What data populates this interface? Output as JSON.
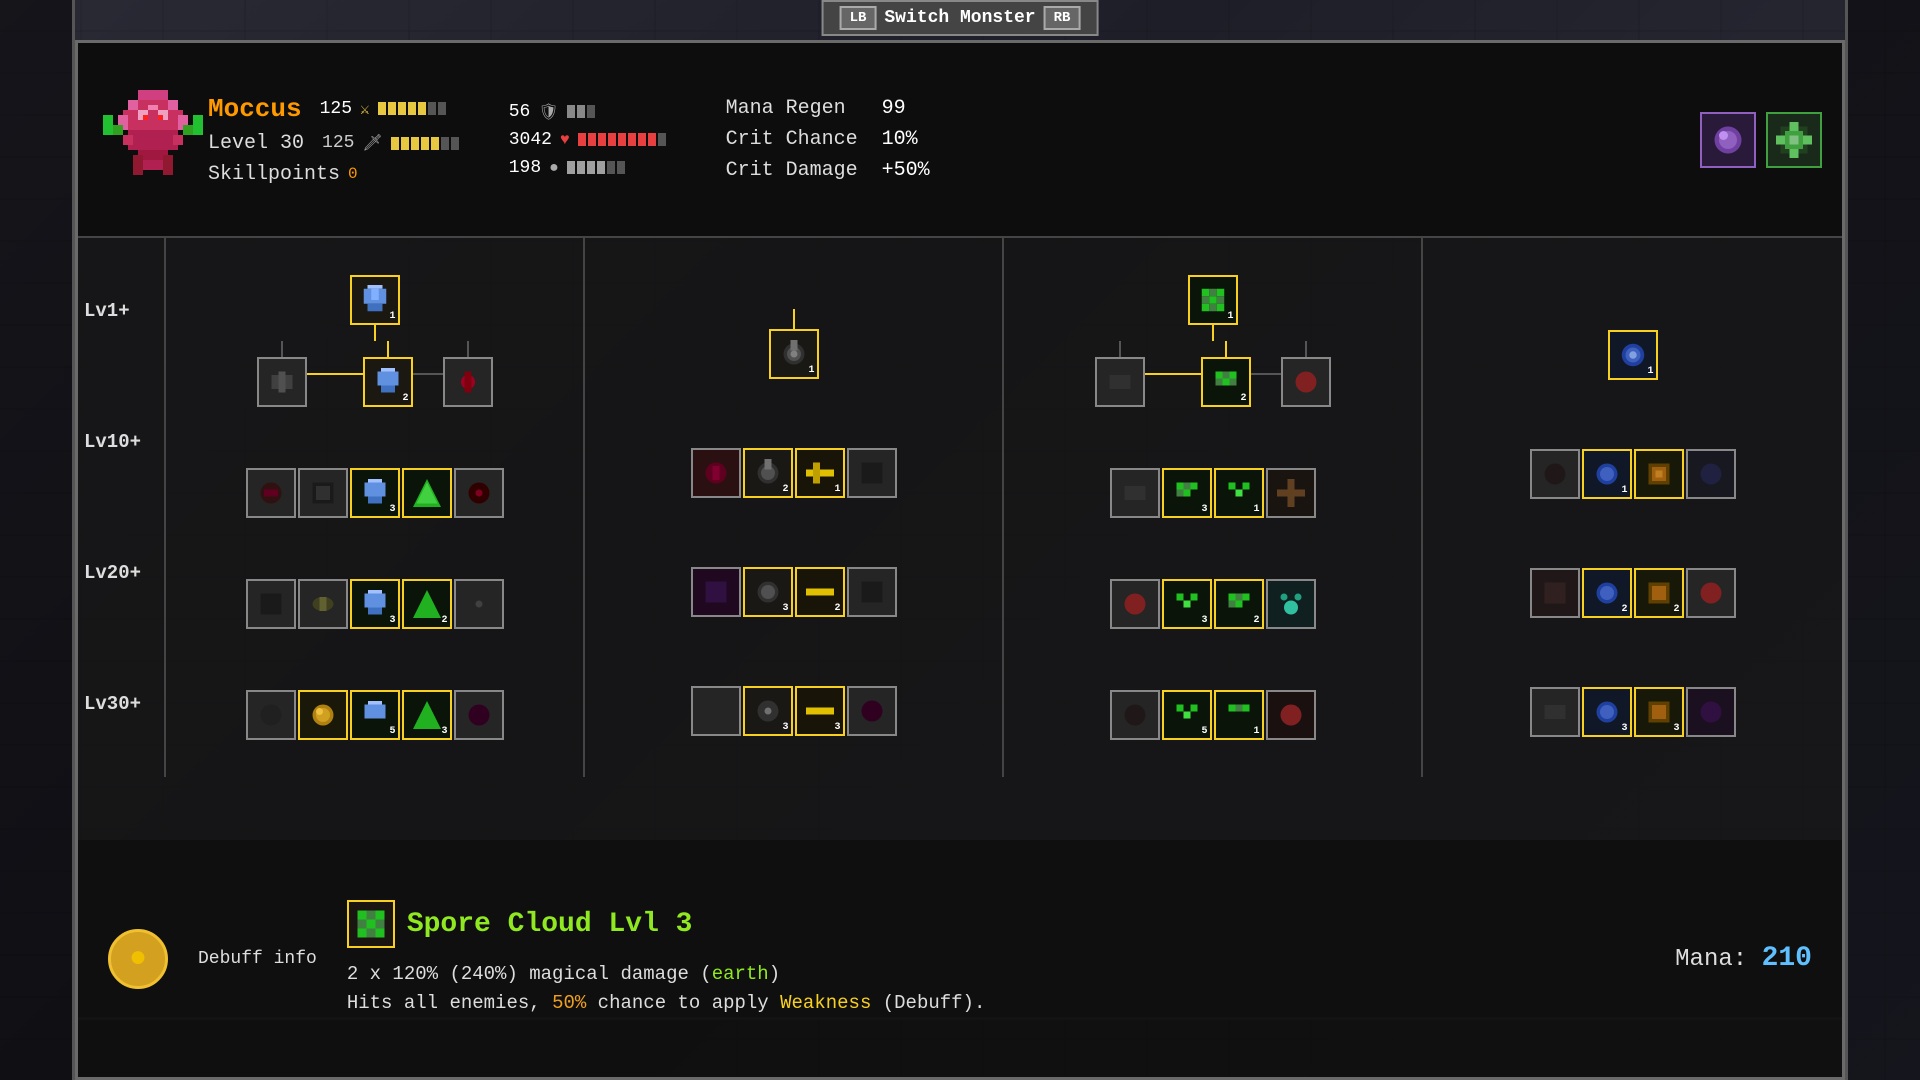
{
  "topBar": {
    "lb": "LB",
    "rb": "RB",
    "switchMonster": "Switch Monster"
  },
  "monster": {
    "name": "Moccus",
    "level": "Level 30",
    "skillpoints_label": "Skillpoints",
    "skillpoints_val": "0",
    "atk": "125",
    "def": "125",
    "shield": "56",
    "hp": "3042",
    "mana": "198"
  },
  "stats_right": {
    "mana_regen_label": "Mana Regen",
    "mana_regen_val": "99",
    "crit_chance_label": "Crit Chance",
    "crit_chance_val": "10%",
    "crit_damage_label": "Crit Damage",
    "crit_damage_val": "+50%"
  },
  "level_labels": [
    "Lv1+",
    "Lv10+",
    "Lv20+",
    "Lv30+"
  ],
  "bottom": {
    "debuff_label": "Debuff info",
    "skill_name": "Spore Cloud Lvl 3",
    "skill_desc_1": "2 x 120% (240%) magical damage (",
    "skill_desc_earth": "earth",
    "skill_desc_1b": ")",
    "skill_desc_2": "Hits all enemies, ",
    "skill_desc_50": "50%",
    "skill_desc_2b": " chance to apply ",
    "skill_desc_weakness": "Weakness",
    "skill_desc_2c": " (Debuff).",
    "mana_label": "Mana: ",
    "mana_val": "210"
  }
}
